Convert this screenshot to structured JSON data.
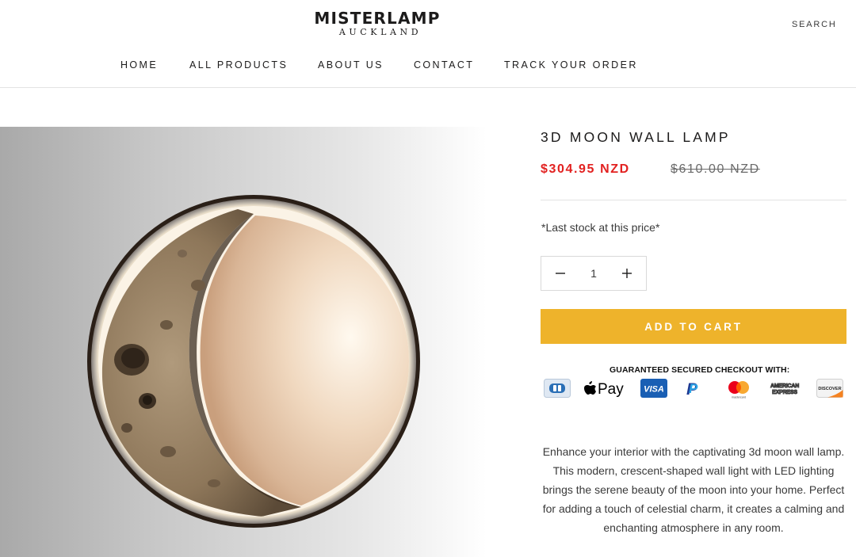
{
  "header": {
    "logo_main": "MISTERLAMP",
    "logo_sub": "AUCKLAND",
    "search_label": "SEARCH"
  },
  "nav": {
    "items": [
      {
        "label": "HOME"
      },
      {
        "label": "ALL PRODUCTS"
      },
      {
        "label": "ABOUT US"
      },
      {
        "label": "CONTACT"
      },
      {
        "label": "TRACK YOUR ORDER"
      }
    ]
  },
  "product": {
    "title": "3D MOON WALL LAMP",
    "price": "$304.95 NZD",
    "compare_price": "$610.00 NZD",
    "stock_note": "*Last stock at this price*",
    "quantity": "1",
    "add_to_cart_label": "ADD TO CART",
    "description": "Enhance your interior with the captivating 3d moon wall lamp. This modern, crescent-shaped wall light with LED lighting brings the serene beauty of the moon into your home. Perfect for adding a touch of celestial charm, it creates a calming and enchanting atmosphere in any room."
  },
  "checkout": {
    "title": "GUARANTEED SECURED CHECKOUT WITH:",
    "payment_methods": [
      "generic-card-icon",
      "apple-pay-icon",
      "visa-icon",
      "paypal-icon",
      "mastercard-icon",
      "american-express-icon",
      "discover-icon"
    ],
    "apple_pay_text": "Pay",
    "visa_text": "VISA",
    "paypal_text": "P",
    "mastercard_text": "mastercard",
    "amex_text_1": "AMERICAN",
    "amex_text_2": "EXPRESS",
    "discover_text": "DISCOVER"
  },
  "colors": {
    "accent": "#eeb32b",
    "sale_price": "#e22120",
    "text": "#1c1b1b"
  }
}
